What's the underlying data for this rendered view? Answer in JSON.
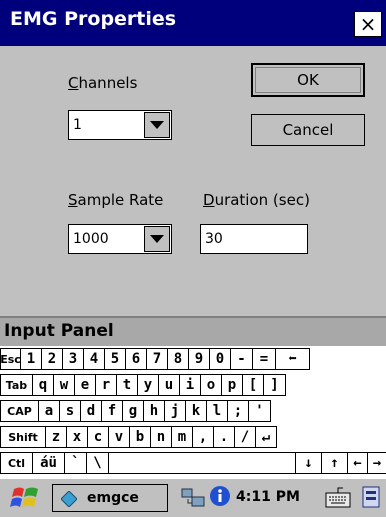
{
  "window": {
    "title": "EMG Properties",
    "close_label": "×"
  },
  "dialog": {
    "channels_label_ul": "C",
    "channels_label_rest": "hannels",
    "channels_value": "1",
    "sample_rate_label_ul": "S",
    "sample_rate_label_rest": "ample Rate",
    "sample_rate_value": "1000",
    "duration_label_ul": "D",
    "duration_label_rest": "uration (sec)",
    "duration_value": "30",
    "ok_label": "OK",
    "cancel_label": "Cancel"
  },
  "input_panel": {
    "title": "Input Panel",
    "rows": [
      [
        "Esc",
        "1",
        "2",
        "3",
        "4",
        "5",
        "6",
        "7",
        "8",
        "9",
        "0",
        "-",
        "=",
        "⬅"
      ],
      [
        "Tab",
        "q",
        "w",
        "e",
        "r",
        "t",
        "y",
        "u",
        "i",
        "o",
        "p",
        "[",
        "]"
      ],
      [
        "CAP",
        "a",
        "s",
        "d",
        "f",
        "g",
        "h",
        "j",
        "k",
        "l",
        ";",
        "'"
      ],
      [
        "Shift",
        "z",
        "x",
        "c",
        "v",
        "b",
        "n",
        "m",
        ",",
        ".",
        "/",
        "↵"
      ],
      [
        "Ctl",
        "áü",
        "`",
        "\\",
        " ",
        "↓",
        "↑",
        "←",
        "→"
      ]
    ]
  },
  "taskbar": {
    "app_label": "emgce",
    "clock": "4:11 PM"
  }
}
